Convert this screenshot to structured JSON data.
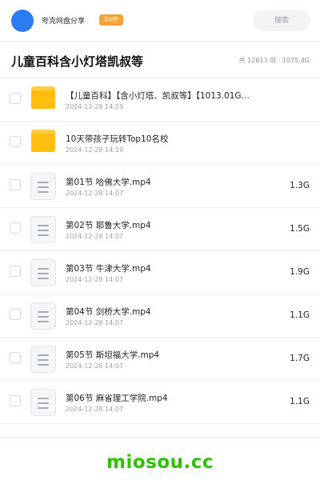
{
  "header": {
    "share_name": "夸克网盘分享",
    "badge": "SVIP",
    "search_placeholder": "搜索"
  },
  "title_bar": {
    "title": "儿童百科含小灯塔凯叔等",
    "stats": "共 12613 项 · 1075.4G"
  },
  "files": [
    {
      "type": "folder",
      "name": "【儿童百科】【含小灯塔、凯叔等】【1013.01G…",
      "date": "2024-12-28 14:19",
      "size": ""
    },
    {
      "type": "folder",
      "name": "10天带孩子玩转Top10名校",
      "date": "2024-12-28 14:19",
      "size": ""
    },
    {
      "type": "file",
      "name": "第01节 哈佛大学.mp4",
      "date": "2024-12-28 14:07",
      "size": "1.3G"
    },
    {
      "type": "file",
      "name": "第02节 耶鲁大学.mp4",
      "date": "2024-12-28 14:07",
      "size": "1.5G"
    },
    {
      "type": "file",
      "name": "第03节 牛津大学.mp4",
      "date": "2024-12-28 14:07",
      "size": "1.9G"
    },
    {
      "type": "file",
      "name": "第04节 剑桥大学.mp4",
      "date": "2024-12-28 14:07",
      "size": "1.1G"
    },
    {
      "type": "file",
      "name": "第05节 斯坦福大学.mp4",
      "date": "2024-12-28 14:07",
      "size": "1.7G"
    },
    {
      "type": "file",
      "name": "第06节 麻省理工学院.mp4",
      "date": "2024-12-28 14:07",
      "size": "1.1G"
    }
  ],
  "watermark": "miosou.cc",
  "colors": {
    "avatar": "#2d7bf3",
    "svip": "#f6a23a",
    "folder": "#ffbe10",
    "watermark": "#2dc100"
  },
  "icons": {
    "folder": "folder-icon",
    "file": "video-file-icon"
  }
}
